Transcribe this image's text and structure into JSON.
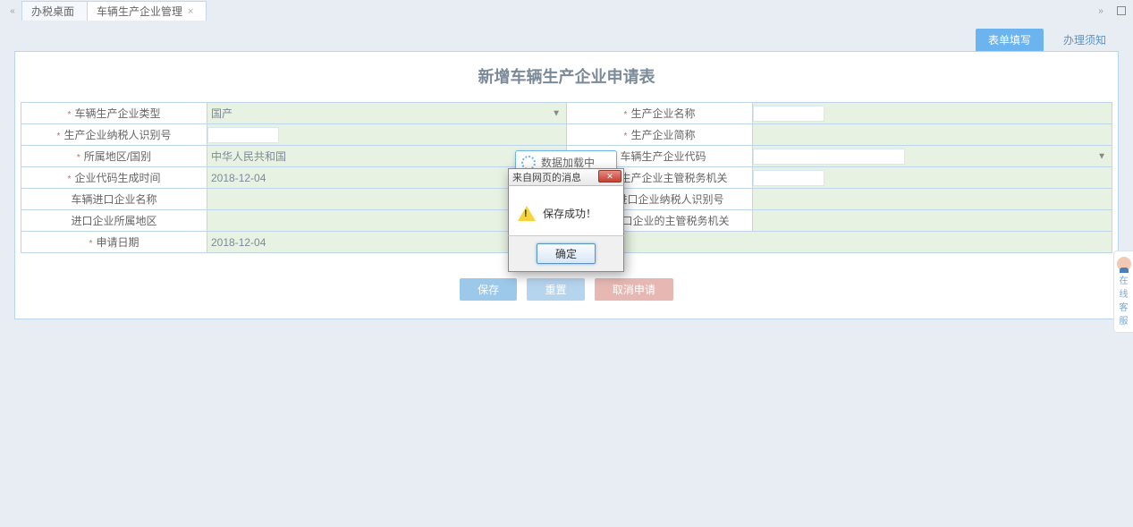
{
  "tabs": {
    "items": [
      {
        "label": "办税桌面",
        "closable": false
      },
      {
        "label": "车辆生产企业管理",
        "closable": true
      }
    ]
  },
  "actionTabs": {
    "primary": "表单填写",
    "secondary": "办理须知"
  },
  "panel": {
    "title": "新增车辆生产企业申请表"
  },
  "form": {
    "row1": {
      "label_l": "车辆生产企业类型",
      "value_l": "国产",
      "label_r": "生产企业名称"
    },
    "row2": {
      "label_l": "生产企业纳税人识别号",
      "label_r": "生产企业简称"
    },
    "row3": {
      "label_l": "所属地区/国别",
      "value_l": "中华人民共和国",
      "label_r": "车辆生产企业代码"
    },
    "row4": {
      "label_l": "企业代码生成时间",
      "value_l": "2018-12-04",
      "label_r": "车辆生产企业主管税务机关"
    },
    "row5": {
      "label_l": "车辆进口企业名称",
      "label_r": "车辆进口企业纳税人识别号"
    },
    "row6": {
      "label_l": "进口企业所属地区",
      "label_r": "车辆进口企业的主管税务机关"
    },
    "row7": {
      "label_l": "申请日期",
      "value_l": "2018-12-04"
    }
  },
  "buttons": {
    "save": "保存",
    "reset": "重置",
    "cancel": "取消申请"
  },
  "loading": {
    "text": "数据加载中"
  },
  "modal": {
    "title": "来自网页的消息",
    "message": "保存成功！",
    "ok": "确定"
  },
  "sideHelper": {
    "line1": "在线",
    "line2": "客服"
  }
}
